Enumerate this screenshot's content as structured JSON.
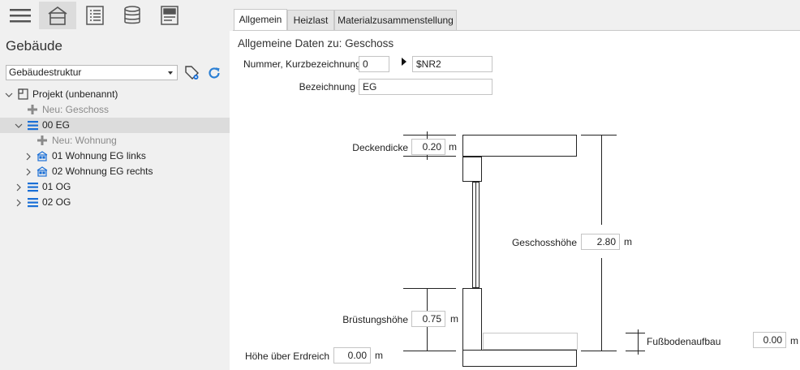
{
  "toolbar": {
    "items": [
      {
        "icon": "hamburger-menu-icon"
      },
      {
        "icon": "building-icon",
        "active": true
      },
      {
        "icon": "list-icon"
      },
      {
        "icon": "database-icon"
      },
      {
        "icon": "form-icon"
      }
    ]
  },
  "sidebar": {
    "title": "Gebäude",
    "structure_select": "Gebäudestruktur",
    "tree": [
      {
        "label": "Projekt (unbenannt)",
        "level": 0,
        "icon": "project-icon",
        "expanded": true
      },
      {
        "label": "Neu: Geschoss",
        "level": 1,
        "icon": "plus-icon",
        "muted": true
      },
      {
        "label": "00 EG",
        "level": 1,
        "icon": "floor-icon",
        "expanded": true,
        "selected": true
      },
      {
        "label": "Neu: Wohnung",
        "level": 2,
        "icon": "plus-icon",
        "muted": true
      },
      {
        "label": "01 Wohnung EG links",
        "level": 2,
        "icon": "apartment-icon",
        "expandable": true
      },
      {
        "label": "02 Wohnung EG rechts",
        "level": 2,
        "icon": "apartment-icon",
        "expandable": true
      },
      {
        "label": "01 OG",
        "level": 1,
        "icon": "floor-icon",
        "expandable": true
      },
      {
        "label": "02 OG",
        "level": 1,
        "icon": "floor-icon",
        "expandable": true
      }
    ]
  },
  "tabs": [
    {
      "label": "Allgemein",
      "active": true
    },
    {
      "label": "Heizlast"
    },
    {
      "label": "Materialzusammenstellung"
    }
  ],
  "form": {
    "heading": "Allgemeine Daten zu: Geschoss",
    "number_label": "Nummer, Kurzbezeichnung",
    "number_value": "0",
    "short_value": "$NR2",
    "name_label": "Bezeichnung",
    "name_value": "EG"
  },
  "diagram": {
    "deckendicke_label": "Deckendicke",
    "deckendicke_value": "0.20",
    "geschosshoehe_label": "Geschosshöhe",
    "geschosshoehe_value": "2.80",
    "bruestungshoehe_label": "Brüstungshöhe",
    "bruestungshoehe_value": "0.75",
    "hoehe_erdreich_label": "Höhe über Erdreich",
    "hoehe_erdreich_value": "0.00",
    "fussbodenaufbau_label": "Fußbodenaufbau",
    "fussbodenaufbau_value": "0.00",
    "unit": "m"
  },
  "colors": {
    "sidebar_bg": "#f0f0f0",
    "selected_bg": "#dcdcdc",
    "accent_blue": "#1a6fd6",
    "refresh_blue": "#2a7fd4"
  }
}
